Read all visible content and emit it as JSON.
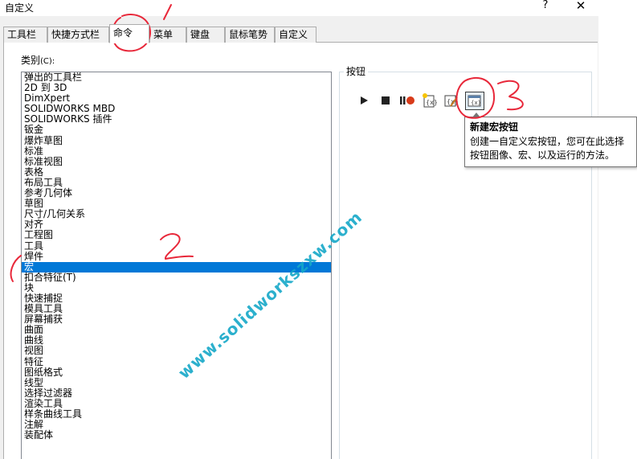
{
  "window": {
    "title": "自定义",
    "help_glyph": "?",
    "close_glyph": "✕"
  },
  "tabs": [
    {
      "label": "工具栏"
    },
    {
      "label": "快捷方式栏"
    },
    {
      "label": "命令",
      "active": true
    },
    {
      "label": "菜单"
    },
    {
      "label": "键盘"
    },
    {
      "label": "鼠标笔势"
    },
    {
      "label": "自定义"
    }
  ],
  "category": {
    "label": "类别",
    "label_suffix": "(C):",
    "items": [
      "弹出的工具栏",
      "2D 到 3D",
      "DimXpert",
      "SOLIDWORKS MBD",
      "SOLIDWORKS 插件",
      "钣金",
      "爆炸草图",
      "标准",
      "标准视图",
      "表格",
      "布局工具",
      "参考几何体",
      "草图",
      "尺寸/几何关系",
      "对齐",
      "工程图",
      "工具",
      "焊件",
      "宏",
      "扣合特征(T)",
      "块",
      "快速捕捉",
      "模具工具",
      "屏幕捕获",
      "曲面",
      "曲线",
      "视图",
      "特征",
      "图纸格式",
      "线型",
      "选择过滤器",
      "渲染工具",
      "样条曲线工具",
      "注解",
      "装配体"
    ],
    "selected_index": 18
  },
  "buttons": {
    "label": "按钮",
    "icons": [
      "play-icon",
      "stop-icon",
      "pause-record-icon",
      "new-macro-icon",
      "edit-macro-icon",
      "new-macro-button-icon"
    ]
  },
  "tooltip": {
    "title": "新建宏按钮",
    "body_line1": "创建一自定义宏按钮，您可在此选择",
    "body_line2": "按钮图像、宏、以及运行的方法。"
  },
  "watermark": "www.solidworkszxw.com",
  "colors": {
    "selection": "#0078d7",
    "annotation": "#e8283a",
    "watermark": "#16a8c8"
  }
}
